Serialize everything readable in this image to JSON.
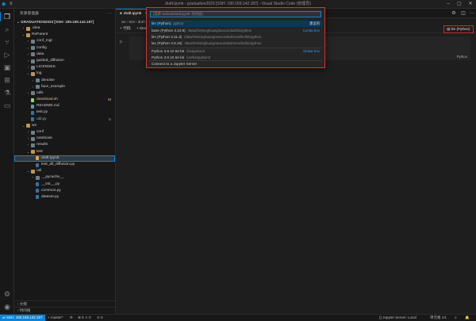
{
  "window": {
    "title": "draft.ipynb - graduation2023 [SSH: 180.169.142.187] - Visual Studio Code (管理员)"
  },
  "explorer": {
    "header": "资源管理器",
    "workspace": "GRADUATION2023 [SSH: 180.169.142.187]",
    "rows": [
      {
        "label": ".idea",
        "chev": "›",
        "depth": 1,
        "icon": "folder",
        "color": "#c09553"
      },
      {
        "label": "ReParent",
        "chev": "⌄",
        "depth": 1,
        "icon": "folder",
        "color": "#c09553"
      },
      {
        "label": "conf_mgt",
        "chev": "›",
        "depth": 2,
        "icon": "folder",
        "color": "#6d8086"
      },
      {
        "label": "config",
        "chev": "›",
        "depth": 2,
        "icon": "folder",
        "color": "#6d8086"
      },
      {
        "label": "data",
        "chev": "›",
        "depth": 2,
        "icon": "folder",
        "color": "#6d8086"
      },
      {
        "label": "guided_diffusion",
        "chev": "›",
        "depth": 2,
        "icon": "folder",
        "color": "#6d8086"
      },
      {
        "label": "LICENSES",
        "chev": "›",
        "depth": 2,
        "icon": "folder",
        "color": "#6d8086"
      },
      {
        "label": "log",
        "chev": "⌄",
        "depth": 2,
        "icon": "folder",
        "color": "#c09553"
      },
      {
        "label": "denoise",
        "chev": "›",
        "depth": 3,
        "icon": "folder",
        "color": "#6d8086"
      },
      {
        "label": "face_example",
        "chev": "›",
        "depth": 3,
        "icon": "folder",
        "color": "#6d8086"
      },
      {
        "label": "utils",
        "chev": "›",
        "depth": 2,
        "icon": "folder",
        "color": "#6d8086"
      },
      {
        "label": "download.sh",
        "chev": "",
        "depth": 2,
        "icon": "file",
        "color": "#89e051",
        "badge": "M",
        "badgeColor": "#e2c08d",
        "labelColor": "#e2c08d"
      },
      {
        "label": "README.md",
        "chev": "",
        "depth": 2,
        "icon": "file",
        "color": "#519aba"
      },
      {
        "label": "test.py",
        "chev": "",
        "depth": 2,
        "icon": "file",
        "color": "#3572a5"
      },
      {
        "label": "util.py",
        "chev": "",
        "depth": 2,
        "icon": "file",
        "color": "#3572a5",
        "badge": "U",
        "badgeColor": "#73c991",
        "labelColor": "#73c991"
      },
      {
        "label": "ws",
        "chev": "⌄",
        "depth": 1,
        "icon": "folder",
        "color": "#c09553"
      },
      {
        "label": "conf",
        "chev": "›",
        "depth": 2,
        "icon": "folder",
        "color": "#6d8086"
      },
      {
        "label": "notebook",
        "chev": "›",
        "depth": 2,
        "icon": "folder",
        "color": "#6d8086"
      },
      {
        "label": "results",
        "chev": "›",
        "depth": 2,
        "icon": "folder",
        "color": "#6d8086"
      },
      {
        "label": "test",
        "chev": "⌄",
        "depth": 2,
        "icon": "folder",
        "color": "#c09553"
      },
      {
        "label": "draft.ipynb",
        "chev": "",
        "depth": 3,
        "icon": "file",
        "color": "#e8a33c",
        "selected": true
      },
      {
        "label": "test_alt_diffusion.py",
        "chev": "",
        "depth": 3,
        "icon": "file",
        "color": "#3572a5"
      },
      {
        "label": "util",
        "chev": "⌄",
        "depth": 2,
        "icon": "folder",
        "color": "#c09553"
      },
      {
        "label": "__pycache__",
        "chev": "›",
        "depth": 3,
        "icon": "folder",
        "color": "#6d8086"
      },
      {
        "label": "__init__.py",
        "chev": "",
        "depth": 3,
        "icon": "file",
        "color": "#3572a5"
      },
      {
        "label": "common.py",
        "chev": "",
        "depth": 3,
        "icon": "file",
        "color": "#3572a5"
      },
      {
        "label": "dataset.py",
        "chev": "",
        "depth": 3,
        "icon": "file",
        "color": "#3572a5"
      }
    ],
    "footer": {
      "outline": "大纲",
      "timeline": "时间线"
    }
  },
  "editor": {
    "tab": {
      "label": "draft.ipynb"
    },
    "breadcrumb": "ws › test › draft.ipynb",
    "toolbar": {
      "code": "+ 代码",
      "markdown": "+ Markdown"
    },
    "cell_language": "Python",
    "kernel_label": "lim (Python)"
  },
  "quickpick": {
    "placeholder": "[选择 'ws/test/draft.ipynb' 的内核]",
    "items": [
      {
        "label": "lim (Python)",
        "detail": "python",
        "right": "建议的",
        "highlight": true
      },
      {
        "label": "base (Python 3.10.9)",
        "detail": "/data/zhekonghuang/anaconda3/bin/python",
        "right": "Conda Env"
      },
      {
        "label": "lim (Python 3.11.3)",
        "detail": "/data/zhekonghuang/anaconda3/envs/lim/bin/python",
        "right": ""
      },
      {
        "label": "lac (Python 3.8.16)",
        "detail": "/data/zhekonghuang/anaconda3/envs/lac/bin/python",
        "right": ""
      },
      {
        "label": "Python 3.8.10 64-bit",
        "detail": "/bin/python3",
        "right": "Global Env"
      },
      {
        "label": "Python 3.8.10 64-bit",
        "detail": "/usr/bin/python3",
        "right": ""
      },
      {
        "label": "Connect to a Jupyter Server",
        "detail": "",
        "right": ""
      }
    ]
  },
  "statusbar": {
    "remote": "SSH: 180.169.142.187",
    "branch": "master*",
    "problems": "⊗ 0 ⚠ 0",
    "ports": "⊙ 0",
    "jupyter": "{} Jupyter Server: Local",
    "cell": "单元格 1/1"
  },
  "colors": {
    "accent": "#0a84d8",
    "highlight_border": "#d9322f"
  }
}
